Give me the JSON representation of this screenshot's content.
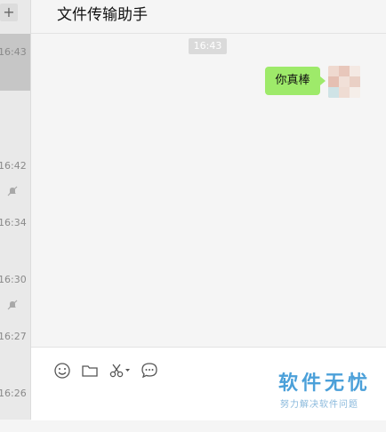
{
  "sidebar": {
    "add_label": "+",
    "conversations": [
      {
        "time": "16:43"
      },
      {
        "time": "16:42"
      },
      {
        "time": "16:34"
      },
      {
        "time": "16:30"
      },
      {
        "time": "16:27"
      },
      {
        "time": "16:26"
      }
    ]
  },
  "chat": {
    "title": "文件传输助手",
    "time_divider": "16:43",
    "messages": [
      {
        "text": "你真棒",
        "sender": "me"
      }
    ]
  },
  "toolbar": {
    "icons": [
      "emoji-icon",
      "folder-icon",
      "scissors-icon",
      "chat-history-icon"
    ]
  },
  "watermark": {
    "title": "软件无忧",
    "subtitle": "努力解决软件问题"
  },
  "colors": {
    "bubble": "#9eea6a",
    "watermark": "#4ba0d9"
  }
}
